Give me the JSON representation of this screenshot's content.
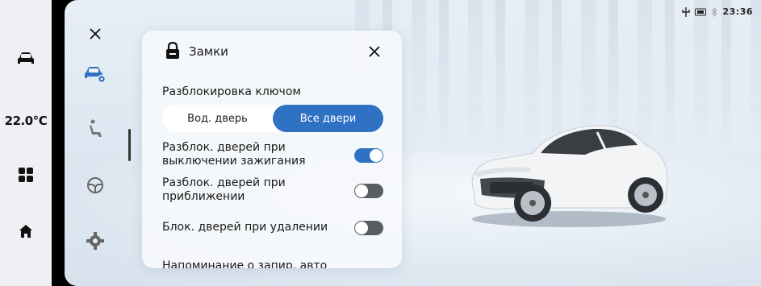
{
  "dock": {
    "temperature": "22.0℃"
  },
  "status": {
    "time": "23:36"
  },
  "panel": {
    "title": "Замки",
    "section_label": "Разблокировка ключом",
    "segments": [
      {
        "label": "Вод. дверь",
        "selected": false
      },
      {
        "label": "Все двери",
        "selected": true
      }
    ],
    "rows": [
      {
        "label": "Разблок. дверей при выключении зажигания",
        "on": true
      },
      {
        "label": "Разблок. дверей при приближении",
        "on": false
      },
      {
        "label": "Блок. дверей при удалении",
        "on": false
      }
    ],
    "cut_off_label": "Напоминание о запир. авто"
  },
  "colors": {
    "accent": "#2f72c4",
    "toggle_off": "#5a5d63"
  },
  "icons": [
    "car-icon",
    "apps-icon",
    "home-icon",
    "close-icon",
    "car-settings-icon",
    "seat-icon",
    "steering-wheel-icon",
    "gear-icon",
    "lock-icon",
    "usb-icon",
    "bluetooth-icon"
  ]
}
